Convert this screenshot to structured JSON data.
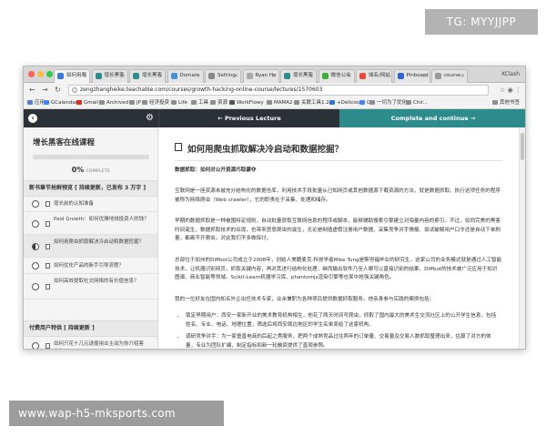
{
  "overlay": {
    "tg_label": "TG: MYYJJPP",
    "watermark": "www.wap-h5-mksports.com"
  },
  "browser": {
    "user": "XClash",
    "tabs": [
      {
        "label": "如何用爬",
        "active": true,
        "color": "#3a7bd5"
      },
      {
        "label": "增长黑客",
        "active": false,
        "color": "#2e8b8b"
      },
      {
        "label": "增长黑客",
        "active": false,
        "color": "#2e8b8b"
      },
      {
        "label": "Domain",
        "active": false,
        "color": "#4a90d9"
      },
      {
        "label": "Setting",
        "active": false,
        "color": "#888888"
      },
      {
        "label": "Ryan Ho",
        "active": false,
        "color": "#aaaaaa"
      },
      {
        "label": "增长黑客",
        "active": false,
        "color": "#2e8b8b"
      },
      {
        "label": "微信公众",
        "active": false,
        "color": "#3cb034"
      },
      {
        "label": "域名/网站",
        "active": false,
        "color": "#e8483c"
      },
      {
        "label": "Pinboard",
        "active": false,
        "color": "#3366cc"
      },
      {
        "label": "course",
        "active": false,
        "color": "#999999"
      }
    ],
    "url": "zengzhangheike.teachable.com/courses/growth-hacking-online-course/lectures/1570603",
    "bookmarks": [
      {
        "label": "应用",
        "color": "#5b7bd5"
      },
      {
        "label": "GCalendar",
        "color": "#4285f4"
      },
      {
        "label": "Gmail",
        "color": "#d93025"
      },
      {
        "label": "Archived",
        "color": "#8e8e8e"
      },
      {
        "label": "JP",
        "color": "#8e8e8e"
      },
      {
        "label": "经济投资",
        "color": "#8e8e8e"
      },
      {
        "label": "Life",
        "color": "#8e8e8e"
      },
      {
        "label": "工具",
        "color": "#8e8e8e"
      },
      {
        "label": "资源",
        "color": "#8e8e8e"
      },
      {
        "label": "WorkFlowy",
        "color": "#555555"
      },
      {
        "label": "MAMA2",
        "color": "#8e8e8e"
      },
      {
        "label": "关联工具1.2",
        "color": "#8e8e8e"
      },
      {
        "label": "+Delicious",
        "color": "#3274d1"
      },
      {
        "label": "G",
        "color": "#4285f4"
      },
      {
        "label": "一切为了优化",
        "color": "#8e8e8e"
      },
      {
        "label": "Chir...",
        "color": "#8e8e8e"
      }
    ],
    "other_bookmarks": "其他书签"
  },
  "course_nav": {
    "prev_label": "Previous Lecture",
    "next_label": "Complete and continue"
  },
  "sidebar": {
    "course_title": "增长黑客在线课程",
    "progress_percent": 0,
    "progress_text": "0%",
    "complete_word": "COMPLETE",
    "section1_title": "新书章节抢鲜预览 [ 持续更新，已发布 3 万字 ]",
    "lessons": [
      {
        "label": "增长前的认知准备",
        "state": "empty"
      },
      {
        "label": "Paid Growth：如何优雅地烧投资人的钱？",
        "state": "empty"
      },
      {
        "label": "如何用爬虫抓取解决冷启动和数据挖掘？",
        "state": "current"
      },
      {
        "label": "如何优化产品的新手引导流程？",
        "state": "empty"
      },
      {
        "label": "如何高效提取社交网络的有价值信息？",
        "state": "empty"
      }
    ],
    "section2_title": "付费用户特供 [ 持续更新 ]",
    "section2_lesson": "如何只花十几元请使用业主动为你介绍客户？"
  },
  "lecture": {
    "title": "如何用爬虫抓取解决冷启动和数据挖掘？",
    "subtitle": "数据抓取：如何对公开资源巧取豪夺",
    "p1": "互联网是一座资源未被充分结构化的数据仓库，利用技术手段批量从已知网页或其他数据源下载资源的方法，就是数据抓取。执行这项任务的程序被称为网络爬虫（Web crawler），它的职责在于采集、处理和储存。",
    "p2": "早期的数据抓取是一种被围特定规则，自动批量获取互联网信息的程序或脚本，能够辅助搜索引擎建立对海量内容的索引。不过，如同完美的黑客时间诞生，数据抓取技术的出现，也带来恶意爬虫的滋生，无论是制造虚假注册用户数据、采集竞争对手情报、尝试破解用户口令还是自动下单刷量，都离不开爬虫。对此我们不多做探讨。",
    "p3": "总部位于加州的Diffbot公司成立于2008年，创始人美籍麦克·科技学者Mike Tung是斯坦福毕业的研究生，这家公司的业务模式就是通过人工智能技术，让机器识别网页，抓取关键内容，再对其进行结构化处理，继而输出软件乃至人眼可以直接识别的结果。Diffbot的技术被广泛应用于知识图谱、商业智能等领域。Scikit-Learn机器学习库、phantomjs渲染引擎等也某中抢强关键角色。",
    "p4": "我的一位好友在国内知名外企出任技术专家，业余兼职为各种项目提供数据抓取服务。他亲身参与实践的案例包括：",
    "bullets": [
      "锁定早期用户：西安一家新开业的美术教育机构相生，他花了两天时间写爬虫，抓取了国内最大的美术生交流社区上的公开学生信息，包括姓名、专业、电话、地理位置，筛选后将西安周边地区的学生名单卖给了这家机构。",
      "调研竞争对手：为一家垂直电商的后起之秀服务，把两个成熟竞品过往两年的订单量、交易量及交易人数抓取整理出来，估算了对方的体量，专业为团队扩编，制定指标和新一轮融资提供了直观参照。"
    ]
  },
  "colors": {
    "teal": "#2e8b8b",
    "dark_header": "#2b3137"
  }
}
